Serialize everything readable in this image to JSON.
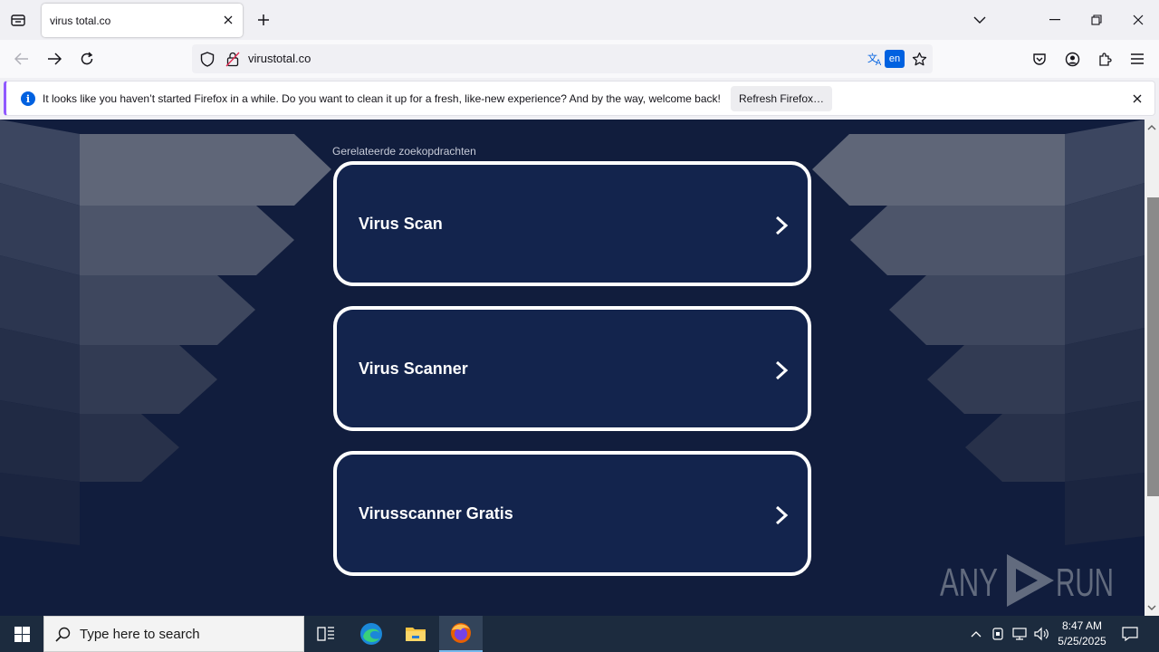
{
  "browser": {
    "tab": {
      "title": "virus total.co"
    },
    "url": "virustotal.co",
    "translate_lang": "en"
  },
  "notification": {
    "info_glyph": "i",
    "message": "It looks like you haven’t started Firefox in a while. Do you want to clean it up for a fresh, like-new experience? And by the way, welcome back!",
    "button_label": "Refresh Firefox…"
  },
  "page": {
    "related_label": "Gerelateerde zoekopdrachten",
    "results": [
      {
        "label": "Virus Scan"
      },
      {
        "label": "Virus Scanner"
      },
      {
        "label": "Virusscanner Gratis"
      }
    ]
  },
  "watermark": {
    "left": "ANY",
    "right": "RUN"
  },
  "taskbar": {
    "search_placeholder": "Type here to search",
    "time": "8:47 AM",
    "date": "5/25/2025"
  },
  "colors": {
    "page_bg": "#111d3d",
    "card_bg": "#13244d",
    "accent": "#0061e0"
  }
}
